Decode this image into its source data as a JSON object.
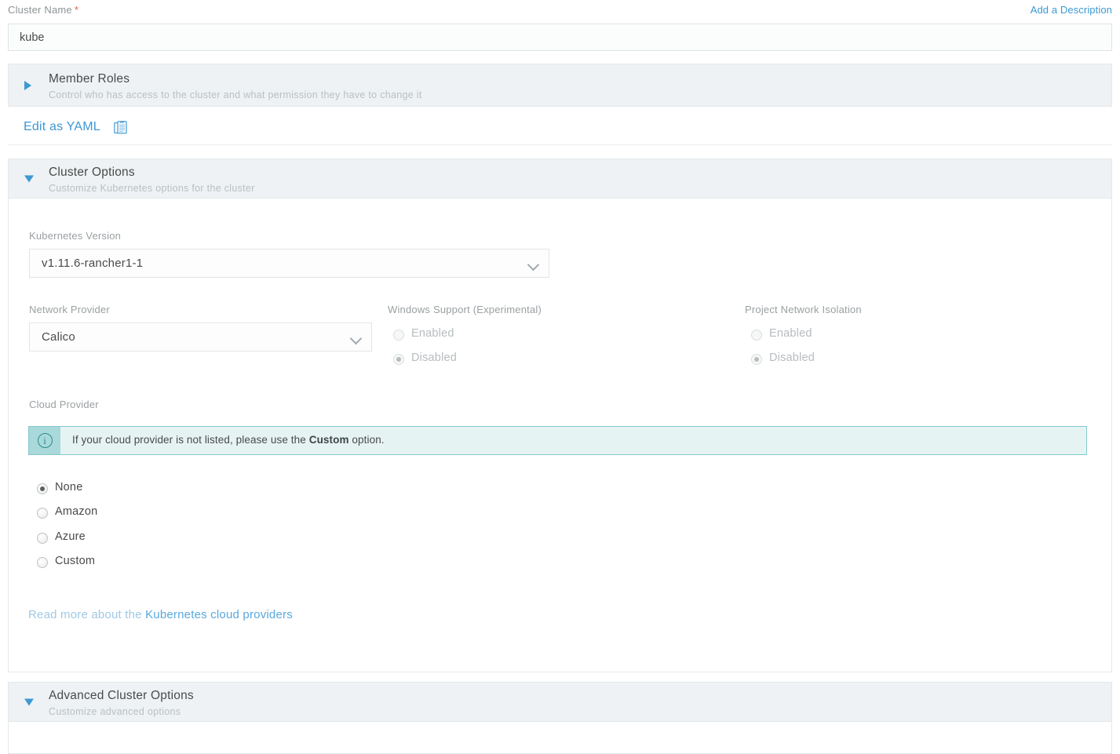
{
  "cluster_name": {
    "label": "Cluster Name",
    "required_marker": "*",
    "value": "kube",
    "add_description_link": "Add a Description"
  },
  "member_roles": {
    "title": "Member Roles",
    "subtitle": "Control who has access to the cluster and what permission they have to change it",
    "expanded": false,
    "caret_icon": "caret-right-icon"
  },
  "yaml": {
    "link_label": "Edit as YAML",
    "icon": "clipboard-copy-icon"
  },
  "cluster_options": {
    "title": "Cluster Options",
    "subtitle": "Customize Kubernetes options for the cluster",
    "expanded": true,
    "caret_icon": "caret-down-icon",
    "kubernetes_version": {
      "label": "Kubernetes Version",
      "value": "v1.11.6-rancher1-1"
    },
    "network_provider": {
      "label": "Network Provider",
      "value": "Calico"
    },
    "windows_support": {
      "label": "Windows Support (Experimental)",
      "options": [
        "Enabled",
        "Disabled"
      ],
      "selected": "Disabled",
      "disabled": true
    },
    "project_network_isolation": {
      "label": "Project Network Isolation",
      "options": [
        "Enabled",
        "Disabled"
      ],
      "selected": "Disabled",
      "disabled": true
    },
    "cloud_provider": {
      "label": "Cloud Provider",
      "banner": {
        "icon": "info-icon",
        "text_before": "If your cloud provider is not listed, please use the ",
        "text_bold": "Custom",
        "text_after": " option."
      },
      "options": [
        "None",
        "Amazon",
        "Azure",
        "Custom"
      ],
      "selected": "None",
      "read_more_prefix": "Read more about the ",
      "read_more_link": "Kubernetes cloud providers"
    }
  },
  "advanced_cluster_options": {
    "title": "Advanced Cluster Options",
    "subtitle": "Customize advanced options",
    "expanded": true,
    "caret_icon": "caret-down-icon"
  },
  "colors": {
    "link": "#3d98d3",
    "header_bg": "#eef2f4",
    "banner_bg": "#e6f3f3",
    "banner_border": "#85c9cc",
    "banner_icon_bg": "#a9d9da",
    "required": "#e8604c"
  }
}
